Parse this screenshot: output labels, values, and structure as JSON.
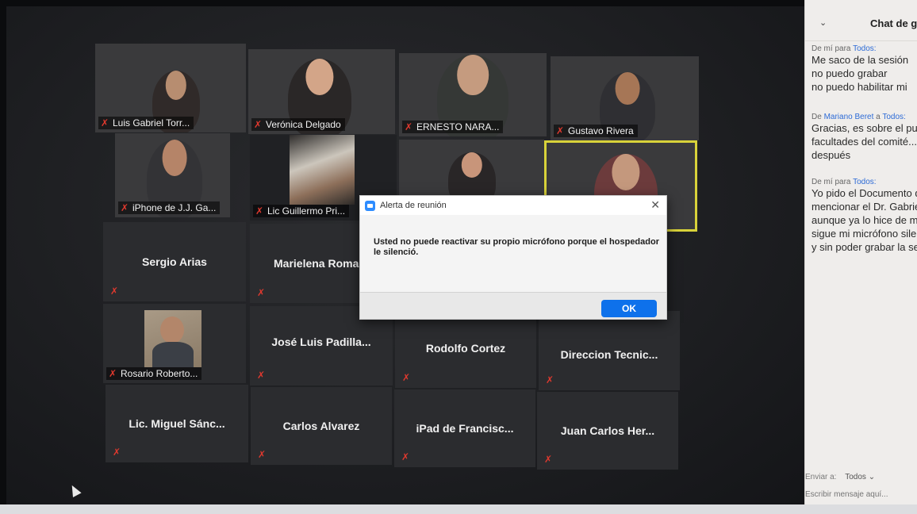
{
  "participants": {
    "row1": [
      {
        "name": "Luis Gabriel Torr..."
      },
      {
        "name": "Verónica Delgado"
      },
      {
        "name": "ERNESTO NARA..."
      },
      {
        "name": "Gustavo Rivera"
      }
    ],
    "row2": [
      {
        "name": "iPhone de J.J. Ga..."
      },
      {
        "name": "Lic Guillermo Pri..."
      }
    ],
    "row3": [
      {
        "name": "Sergio Arias"
      },
      {
        "name": "Marielena Roma"
      }
    ],
    "row4": [
      {
        "name": "Rosario Roberto..."
      },
      {
        "name": "José Luis Padilla..."
      },
      {
        "name": "Rodolfo Cortez"
      },
      {
        "name": "Direccion Tecnic..."
      }
    ],
    "row5": [
      {
        "name": "Lic. Miguel Sánc..."
      },
      {
        "name": "Carlos Alvarez"
      },
      {
        "name": "iPad de Francisc..."
      },
      {
        "name": "Juan Carlos Her..."
      }
    ]
  },
  "dialog": {
    "title": "Alerta de reunión",
    "message": "Usted no puede reactivar su propio micrófono porque el hospedador le silenció.",
    "ok_label": "OK",
    "close": "✕"
  },
  "chat": {
    "title": "Chat de g",
    "messages": [
      {
        "from": "De mí para",
        "to": "Todos:",
        "lines": [
          "Me saco de la sesión",
          "no puedo grabar",
          "no puedo habilitar mi"
        ]
      },
      {
        "from": "De",
        "sender": "Mariano Beret",
        "mid": "a",
        "to": "Todos:",
        "lines": [
          "Gracias, es sobre el pur",
          "facultades del comité...",
          "después"
        ]
      },
      {
        "from": "De mí para",
        "to": "Todos:",
        "lines": [
          "Yo pido el Documento q",
          "mencionar el Dr. Gabriel",
          "aunque ya lo hice de ma",
          "sigue mi micrófono silenc",
          "y sin poder grabar la sesi"
        ]
      }
    ],
    "send_to_label": "Enviar a:",
    "send_to_value": "Todos",
    "input_placeholder": "Escribir mensaje aquí..."
  },
  "colors": {
    "muted_icon": "#e0392e",
    "ok_button": "#0e71eb",
    "active_speaker": "#d8d23a"
  }
}
